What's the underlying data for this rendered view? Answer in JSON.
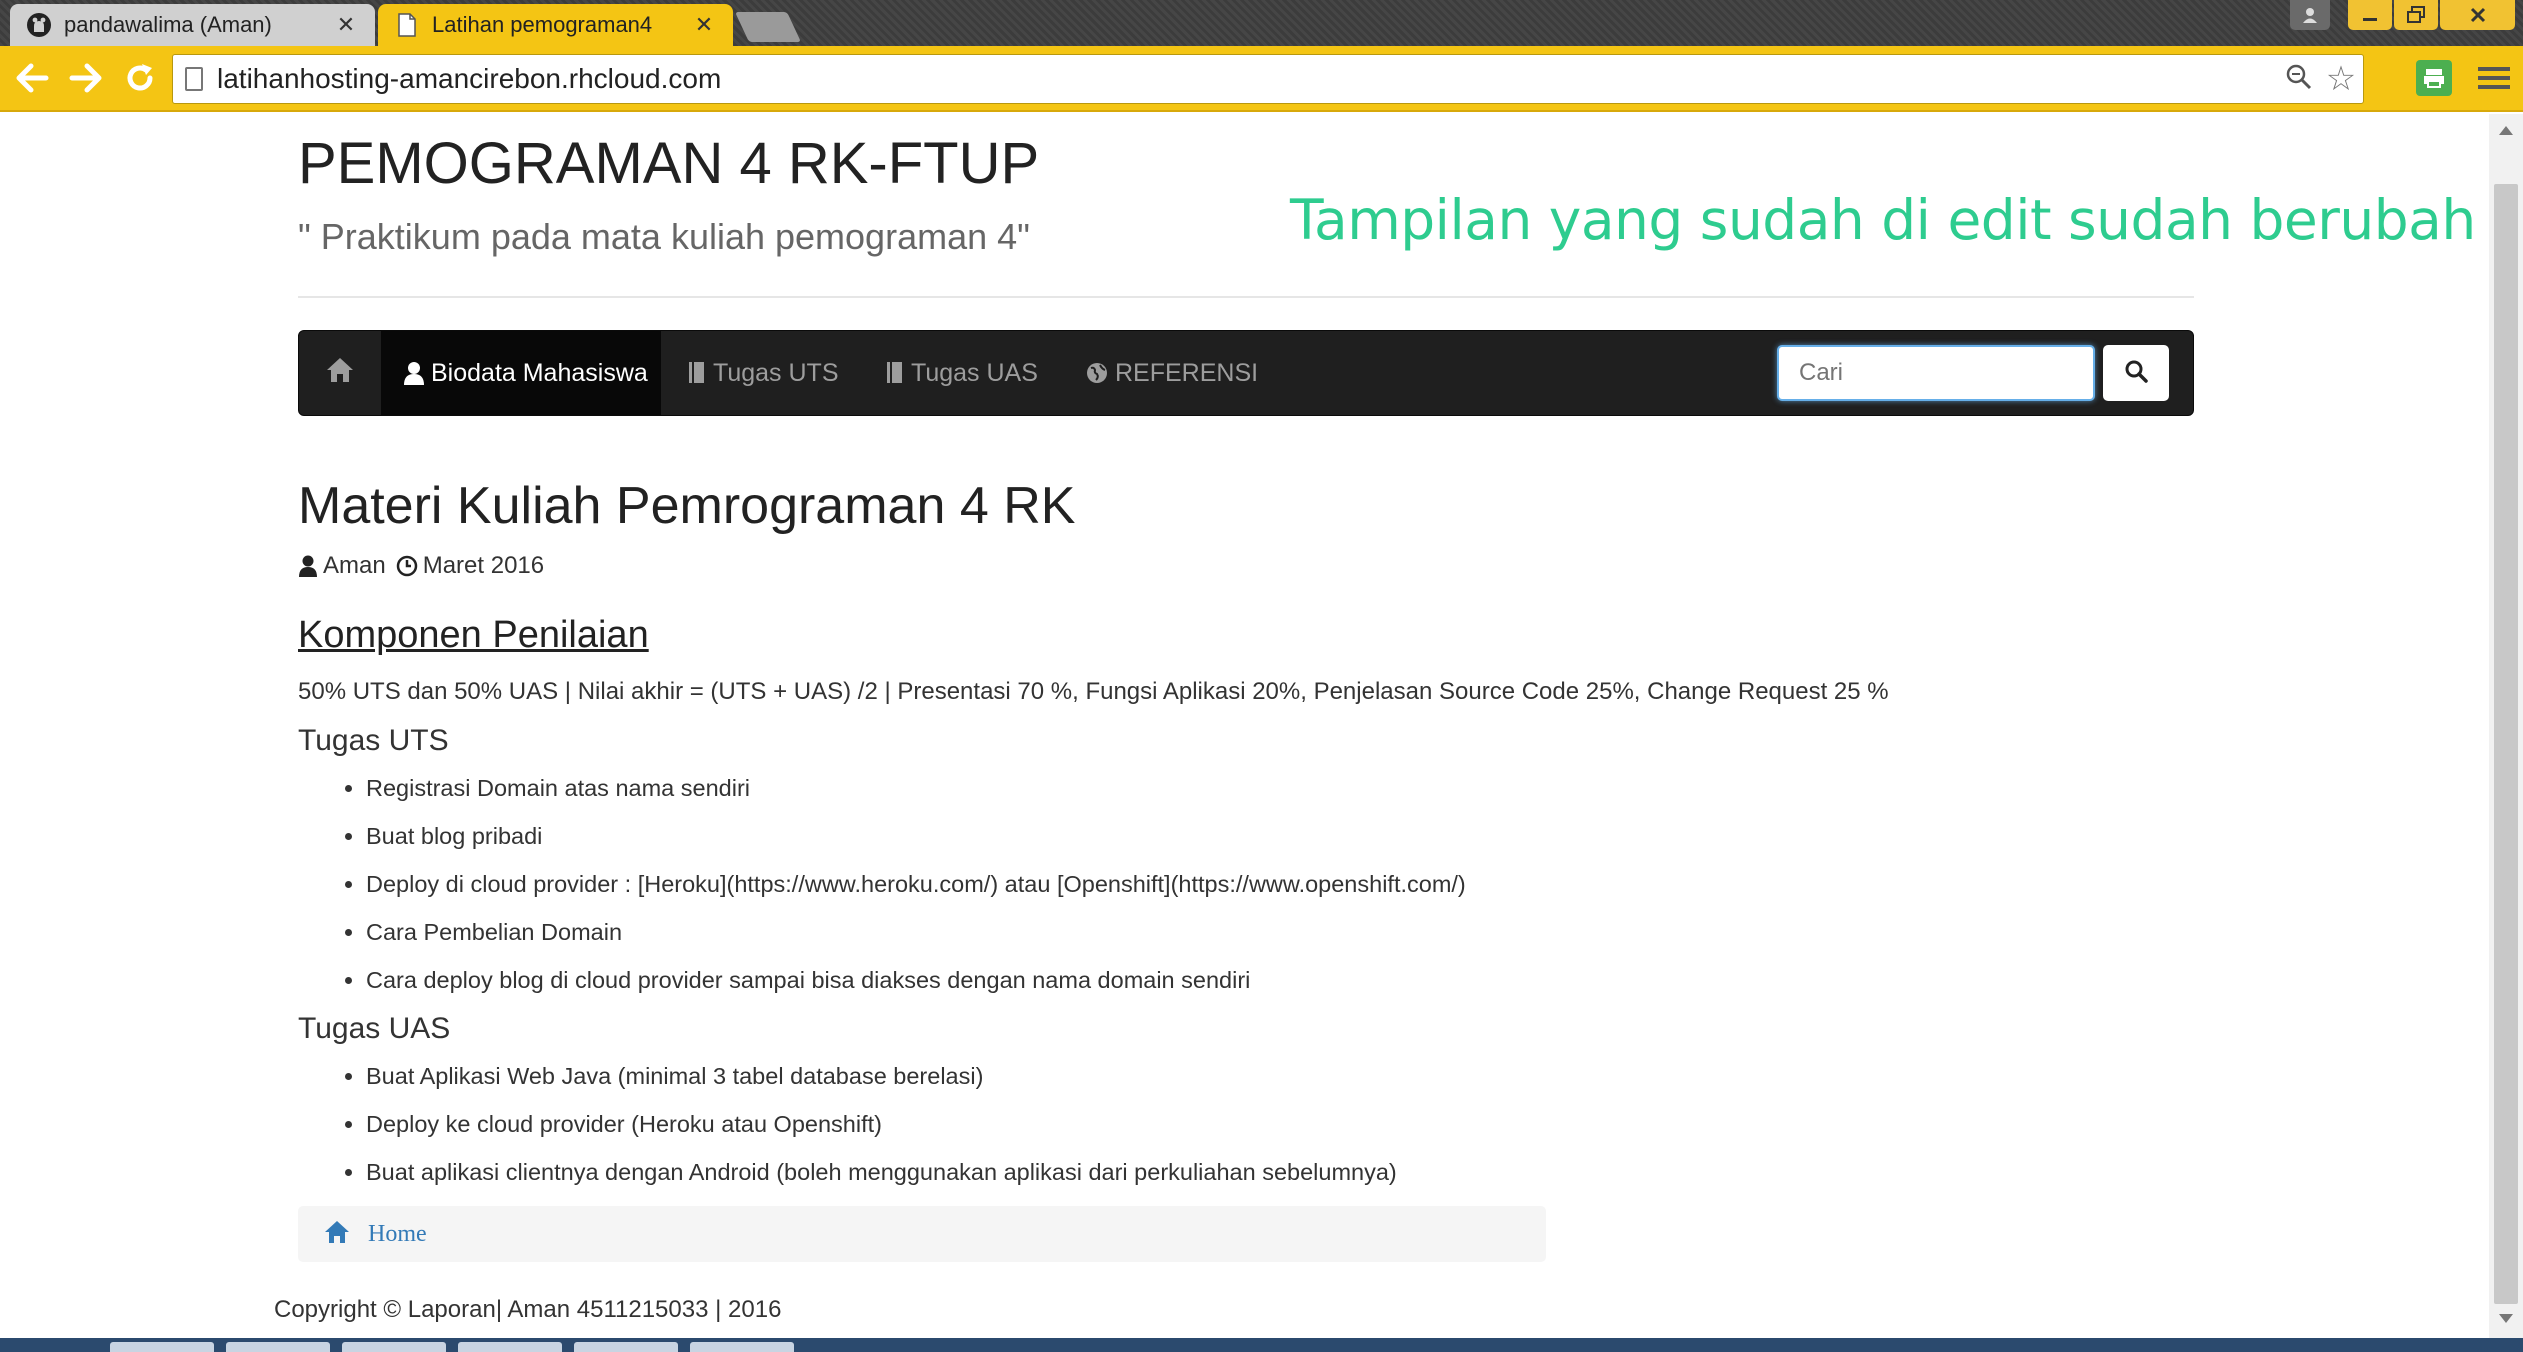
{
  "browser": {
    "tabs": [
      {
        "title": "pandawalima (Aman)",
        "favicon": "github-icon",
        "active": false
      },
      {
        "title": "Latihan pemograman4",
        "favicon": "page-icon",
        "active": true
      }
    ],
    "url": "latihanhosting-amancirebon.rhcloud.com",
    "accent_color": "#f4c514"
  },
  "site": {
    "title": "PEMOGRAMAN 4 RK-FTUP",
    "subtitle": "\" Praktikum pada mata kuliah pemograman 4\"",
    "annotation": "Tampilan yang sudah di edit sudah berubah",
    "annotation_color": "#2ecc8f"
  },
  "navbar": {
    "home_icon": "home-icon",
    "items": [
      {
        "label": "Biodata Mahasiswa",
        "icon": "user-icon",
        "active": true
      },
      {
        "label": "Tugas UTS",
        "icon": "book-icon",
        "active": false
      },
      {
        "label": "Tugas UAS",
        "icon": "book-icon",
        "active": false
      },
      {
        "label": "REFERENSI",
        "icon": "globe-icon",
        "active": false
      }
    ],
    "search_placeholder": "Cari"
  },
  "post": {
    "title": "Materi Kuliah Pemrograman 4 RK",
    "author": "Aman",
    "date": "Maret 2016",
    "section_heading": "Komponen Penilaian",
    "summary": "50% UTS dan 50% UAS | Nilai akhir = (UTS + UAS) /2 | Presentasi 70 %, Fungsi Aplikasi 20%, Penjelasan Source Code 25%, Change Request 25 %",
    "uts": {
      "heading": "Tugas UTS",
      "items": [
        "Registrasi Domain atas nama sendiri",
        "Buat blog pribadi",
        "Deploy di cloud provider : [Heroku](https://www.heroku.com/) atau [Openshift](https://www.openshift.com/)",
        "Cara Pembelian Domain",
        "Cara deploy blog di cloud provider sampai bisa diakses dengan nama domain sendiri"
      ]
    },
    "uas": {
      "heading": "Tugas UAS",
      "items": [
        "Buat Aplikasi Web Java (minimal 3 tabel database berelasi)",
        "Deploy ke cloud provider (Heroku atau Openshift)",
        "Buat aplikasi clientnya dengan Android (boleh menggunakan aplikasi dari perkuliahan sebelumnya)"
      ]
    }
  },
  "breadcrumb": {
    "home_label": "Home"
  },
  "footer": {
    "text": "Copyright © Laporan| Aman 4511215033 | 2016"
  }
}
